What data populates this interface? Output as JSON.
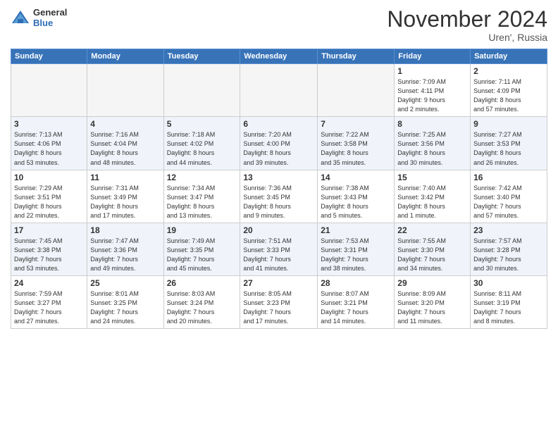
{
  "logo": {
    "general": "General",
    "blue": "Blue"
  },
  "header": {
    "month": "November 2024",
    "location": "Uren', Russia"
  },
  "weekdays": [
    "Sunday",
    "Monday",
    "Tuesday",
    "Wednesday",
    "Thursday",
    "Friday",
    "Saturday"
  ],
  "weeks": [
    [
      {
        "day": "",
        "info": ""
      },
      {
        "day": "",
        "info": ""
      },
      {
        "day": "",
        "info": ""
      },
      {
        "day": "",
        "info": ""
      },
      {
        "day": "",
        "info": ""
      },
      {
        "day": "1",
        "info": "Sunrise: 7:09 AM\nSunset: 4:11 PM\nDaylight: 9 hours\nand 2 minutes."
      },
      {
        "day": "2",
        "info": "Sunrise: 7:11 AM\nSunset: 4:09 PM\nDaylight: 8 hours\nand 57 minutes."
      }
    ],
    [
      {
        "day": "3",
        "info": "Sunrise: 7:13 AM\nSunset: 4:06 PM\nDaylight: 8 hours\nand 53 minutes."
      },
      {
        "day": "4",
        "info": "Sunrise: 7:16 AM\nSunset: 4:04 PM\nDaylight: 8 hours\nand 48 minutes."
      },
      {
        "day": "5",
        "info": "Sunrise: 7:18 AM\nSunset: 4:02 PM\nDaylight: 8 hours\nand 44 minutes."
      },
      {
        "day": "6",
        "info": "Sunrise: 7:20 AM\nSunset: 4:00 PM\nDaylight: 8 hours\nand 39 minutes."
      },
      {
        "day": "7",
        "info": "Sunrise: 7:22 AM\nSunset: 3:58 PM\nDaylight: 8 hours\nand 35 minutes."
      },
      {
        "day": "8",
        "info": "Sunrise: 7:25 AM\nSunset: 3:56 PM\nDaylight: 8 hours\nand 30 minutes."
      },
      {
        "day": "9",
        "info": "Sunrise: 7:27 AM\nSunset: 3:53 PM\nDaylight: 8 hours\nand 26 minutes."
      }
    ],
    [
      {
        "day": "10",
        "info": "Sunrise: 7:29 AM\nSunset: 3:51 PM\nDaylight: 8 hours\nand 22 minutes."
      },
      {
        "day": "11",
        "info": "Sunrise: 7:31 AM\nSunset: 3:49 PM\nDaylight: 8 hours\nand 17 minutes."
      },
      {
        "day": "12",
        "info": "Sunrise: 7:34 AM\nSunset: 3:47 PM\nDaylight: 8 hours\nand 13 minutes."
      },
      {
        "day": "13",
        "info": "Sunrise: 7:36 AM\nSunset: 3:45 PM\nDaylight: 8 hours\nand 9 minutes."
      },
      {
        "day": "14",
        "info": "Sunrise: 7:38 AM\nSunset: 3:43 PM\nDaylight: 8 hours\nand 5 minutes."
      },
      {
        "day": "15",
        "info": "Sunrise: 7:40 AM\nSunset: 3:42 PM\nDaylight: 8 hours\nand 1 minute."
      },
      {
        "day": "16",
        "info": "Sunrise: 7:42 AM\nSunset: 3:40 PM\nDaylight: 7 hours\nand 57 minutes."
      }
    ],
    [
      {
        "day": "17",
        "info": "Sunrise: 7:45 AM\nSunset: 3:38 PM\nDaylight: 7 hours\nand 53 minutes."
      },
      {
        "day": "18",
        "info": "Sunrise: 7:47 AM\nSunset: 3:36 PM\nDaylight: 7 hours\nand 49 minutes."
      },
      {
        "day": "19",
        "info": "Sunrise: 7:49 AM\nSunset: 3:35 PM\nDaylight: 7 hours\nand 45 minutes."
      },
      {
        "day": "20",
        "info": "Sunrise: 7:51 AM\nSunset: 3:33 PM\nDaylight: 7 hours\nand 41 minutes."
      },
      {
        "day": "21",
        "info": "Sunrise: 7:53 AM\nSunset: 3:31 PM\nDaylight: 7 hours\nand 38 minutes."
      },
      {
        "day": "22",
        "info": "Sunrise: 7:55 AM\nSunset: 3:30 PM\nDaylight: 7 hours\nand 34 minutes."
      },
      {
        "day": "23",
        "info": "Sunrise: 7:57 AM\nSunset: 3:28 PM\nDaylight: 7 hours\nand 30 minutes."
      }
    ],
    [
      {
        "day": "24",
        "info": "Sunrise: 7:59 AM\nSunset: 3:27 PM\nDaylight: 7 hours\nand 27 minutes."
      },
      {
        "day": "25",
        "info": "Sunrise: 8:01 AM\nSunset: 3:25 PM\nDaylight: 7 hours\nand 24 minutes."
      },
      {
        "day": "26",
        "info": "Sunrise: 8:03 AM\nSunset: 3:24 PM\nDaylight: 7 hours\nand 20 minutes."
      },
      {
        "day": "27",
        "info": "Sunrise: 8:05 AM\nSunset: 3:23 PM\nDaylight: 7 hours\nand 17 minutes."
      },
      {
        "day": "28",
        "info": "Sunrise: 8:07 AM\nSunset: 3:21 PM\nDaylight: 7 hours\nand 14 minutes."
      },
      {
        "day": "29",
        "info": "Sunrise: 8:09 AM\nSunset: 3:20 PM\nDaylight: 7 hours\nand 11 minutes."
      },
      {
        "day": "30",
        "info": "Sunrise: 8:11 AM\nSunset: 3:19 PM\nDaylight: 7 hours\nand 8 minutes."
      }
    ]
  ]
}
